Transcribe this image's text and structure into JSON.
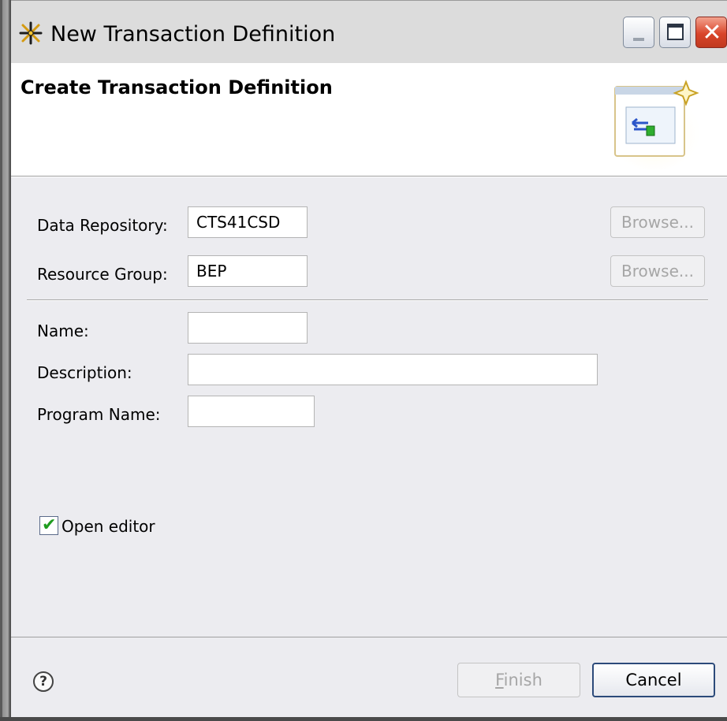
{
  "window": {
    "title": "New Transaction Definition",
    "icon": "wizard-star-icon",
    "controls": {
      "minimize": "minimize-icon",
      "maximize": "maximize-icon",
      "close": "✕"
    }
  },
  "header": {
    "title": "Create Transaction Definition",
    "graphic_icon": "transaction-wizard-icon"
  },
  "form": {
    "data_repository": {
      "label": "Data Repository:",
      "value": "CTS41CSD",
      "browse_label": "Browse...",
      "browse_enabled": false
    },
    "resource_group": {
      "label": "Resource Group:",
      "value": "BEP",
      "browse_label": "Browse...",
      "browse_enabled": false
    },
    "name": {
      "label": "Name:",
      "value": ""
    },
    "description": {
      "label": "Description:",
      "value": ""
    },
    "program_name": {
      "label": "Program Name:",
      "value": ""
    },
    "open_editor": {
      "label": "Open editor",
      "checked": true
    }
  },
  "footer": {
    "help_icon": "help-icon",
    "finish_mnemonic": "F",
    "finish_rest": "inish",
    "finish_enabled": false,
    "cancel_label": "Cancel"
  },
  "colors": {
    "panel_bg": "#ececf0",
    "check_green": "#1f9c1f",
    "disabled_text": "#a6a6a6",
    "default_button_border": "#2c4a7a"
  }
}
